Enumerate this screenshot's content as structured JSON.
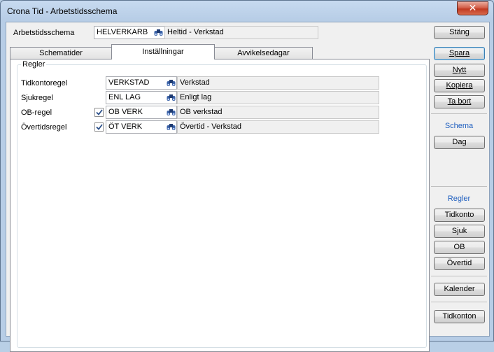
{
  "window": {
    "title": "Crona Tid - Arbetstidsschema",
    "close_glyph": "✕"
  },
  "header": {
    "label": "Arbetstidsschema",
    "code": "HELVERKARB",
    "description": "Heltid - Verkstad",
    "lookup_icon": "binoculars-icon"
  },
  "tabs": [
    {
      "label": "Schematider"
    },
    {
      "label": "Inställningar"
    },
    {
      "label": "Avvikelsedagar"
    }
  ],
  "rules_group": {
    "title": "Regler",
    "rows": [
      {
        "label": "Tidkontoregel",
        "has_checkbox": false,
        "checked": false,
        "code": "VERKSTAD",
        "description": "Verkstad"
      },
      {
        "label": "Sjukregel",
        "has_checkbox": false,
        "checked": false,
        "code": "ENL LAG",
        "description": "Enligt lag"
      },
      {
        "label": "OB-regel",
        "has_checkbox": true,
        "checked": true,
        "code": "OB VERK",
        "description": "OB verkstad"
      },
      {
        "label": "Övertidsregel",
        "has_checkbox": true,
        "checked": true,
        "code": "ÖT VERK",
        "description": "Övertid - Verkstad"
      }
    ]
  },
  "side": {
    "close": "Stäng",
    "save": "Spara",
    "new": "Nytt",
    "copy": "Kopiera",
    "delete": "Ta bort",
    "schema_heading": "Schema",
    "day": "Dag",
    "rules_heading": "Regler",
    "time_account": "Tidkonto",
    "sick": "Sjuk",
    "ob": "OB",
    "overtime": "Övertid",
    "calendar": "Kalender",
    "time_accounts": "Tidkonton"
  },
  "colors": {
    "accent": "#1f5fbf",
    "default_button_border": "#3c7fb1",
    "close_red": "#c13a22"
  }
}
